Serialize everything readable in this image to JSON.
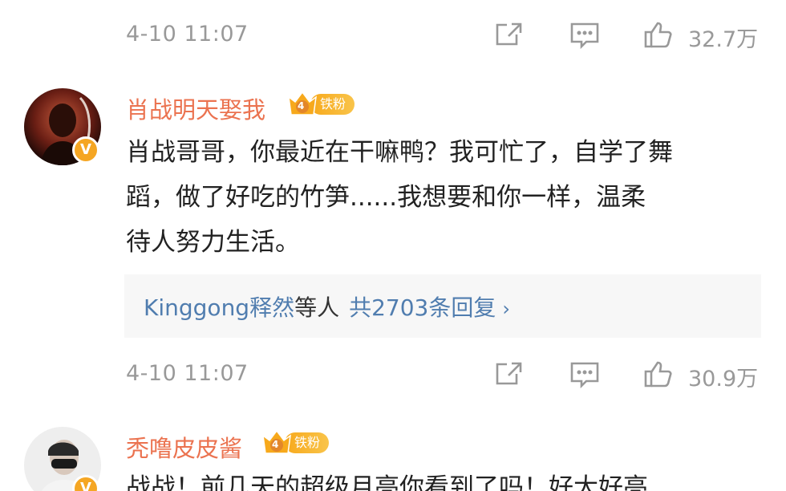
{
  "feed": {
    "top_action_row": {
      "timestamp": "4-10 11:07",
      "like_count": "32.7万"
    },
    "comments": [
      {
        "username": "肖战明天娶我",
        "fan_badge": "铁粉",
        "fan_level": "4",
        "verified_badge": "V",
        "content_lines": [
          "肖战哥哥，你最近在干嘛鸭？我可忙了，自学了舞",
          "蹈，做了好吃的竹笋......我想要和你一样，温柔",
          "待人努力生活。"
        ],
        "replies": {
          "names": "Kinggong释然",
          "suffix": "等人",
          "count": "共2703条回复",
          "arrow": "›"
        },
        "timestamp": "4-10 11:07",
        "like_count": "30.9万"
      },
      {
        "username": "秃噜皮皮酱",
        "fan_badge": "铁粉",
        "fan_level": "4",
        "verified_badge": "V",
        "content_lines": [
          "战战！前几天的超级月亮你看到了吗！好大好亮"
        ]
      }
    ]
  },
  "icons": {
    "share": "share-icon",
    "reply": "comment-icon",
    "like": "thumbs-up-icon"
  },
  "colors": {
    "username": "#eb7350",
    "link": "#507daf",
    "badge": "#f7a91c",
    "meta": "#999999"
  }
}
